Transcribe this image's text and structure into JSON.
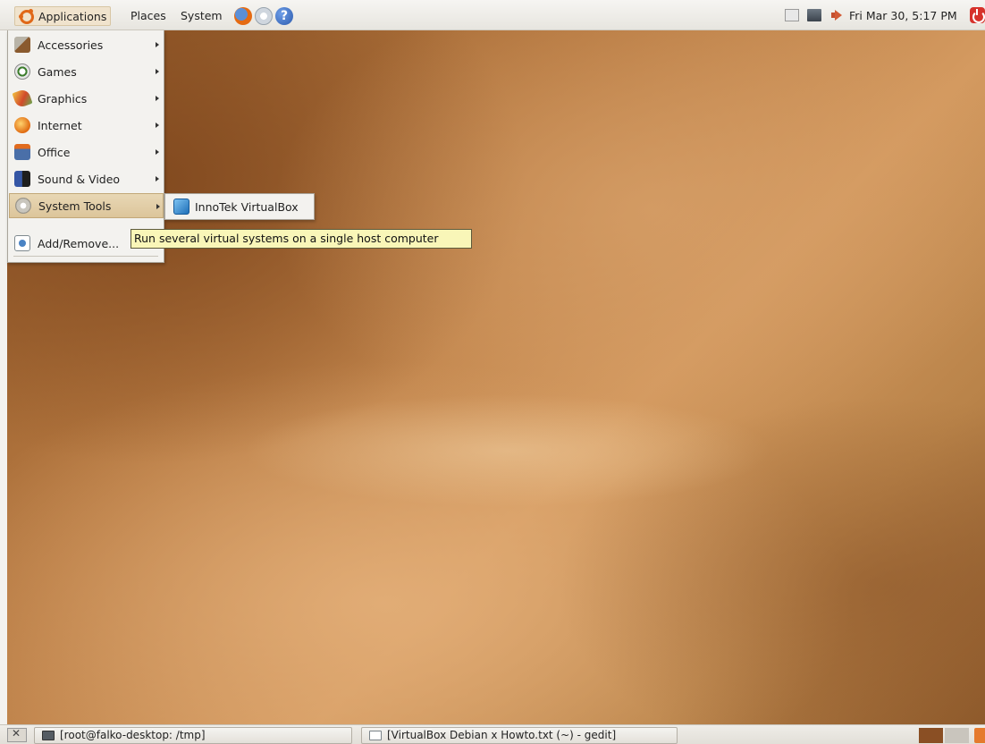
{
  "top_panel": {
    "menus": {
      "applications": "Applications",
      "places": "Places",
      "system": "System"
    },
    "launchers": [
      "firefox-icon",
      "mail-icon",
      "help-icon"
    ],
    "help_glyph": "?",
    "clock": "Fri Mar 30,  5:17 PM"
  },
  "apps_menu": {
    "items": [
      {
        "label": "Accessories",
        "icon": "accessories-icon",
        "has_submenu": true
      },
      {
        "label": "Games",
        "icon": "games-icon",
        "has_submenu": true
      },
      {
        "label": "Graphics",
        "icon": "graphics-icon",
        "has_submenu": true
      },
      {
        "label": "Internet",
        "icon": "internet-icon",
        "has_submenu": true
      },
      {
        "label": "Office",
        "icon": "office-icon",
        "has_submenu": true
      },
      {
        "label": "Sound & Video",
        "icon": "sound-video-icon",
        "has_submenu": true
      },
      {
        "label": "System Tools",
        "icon": "system-tools-icon",
        "has_submenu": true,
        "highlighted": true
      }
    ],
    "add_remove": "Add/Remove..."
  },
  "submenu": {
    "item": {
      "label": "InnoTek VirtualBox",
      "icon": "virtualbox-icon"
    }
  },
  "tooltip": "Run several virtual systems on a single host computer",
  "bottom_panel": {
    "tasks": [
      {
        "label": "[root@falko-desktop: /tmp]",
        "icon": "terminal-icon"
      },
      {
        "label": "[VirtualBox Debian x Howto.txt (~) - gedit]",
        "icon": "gedit-icon"
      }
    ]
  },
  "colors": {
    "accent": "#e06818",
    "menu_highlight": "#dcc59a",
    "tooltip_bg": "#f9f6b8",
    "wallpaper": "#b77a42"
  }
}
